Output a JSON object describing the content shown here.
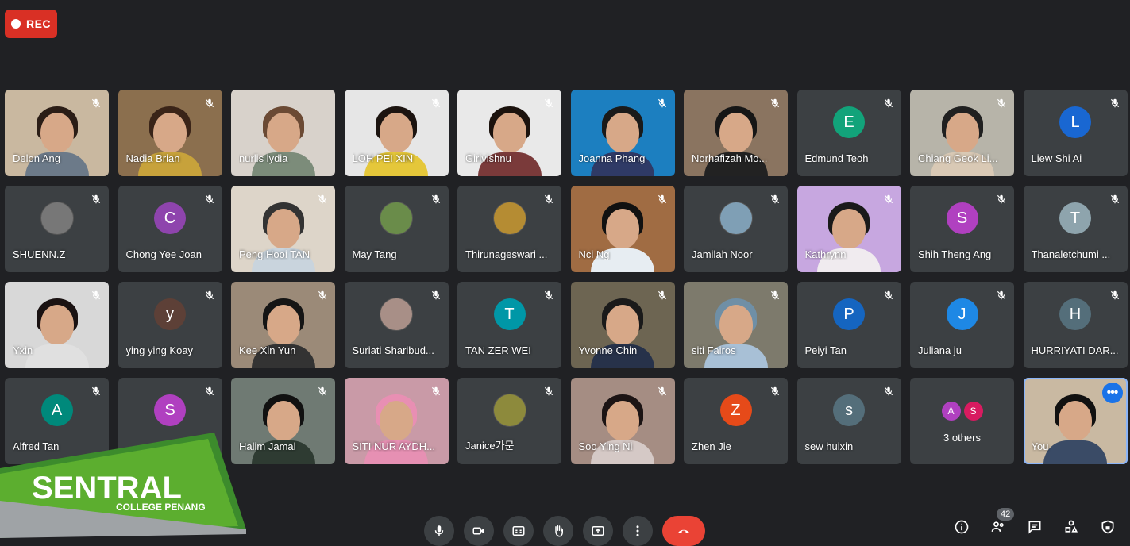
{
  "recording": {
    "label": "REC",
    "color": "#d93025"
  },
  "participants": [
    {
      "name": "Delon Ang",
      "type": "video",
      "bg": "#c9b8a0",
      "hair": "#2b1d16",
      "shirt": "#6c7a89"
    },
    {
      "name": "Nadia Brian",
      "type": "video",
      "bg": "#8b6f4e",
      "hair": "#3a2418",
      "shirt": "#c7a23b"
    },
    {
      "name": "nurlis lydia",
      "type": "video",
      "bg": "#d8d2cb",
      "hair": "#6b4a34",
      "shirt": "#7c8c7a",
      "unmuted": true
    },
    {
      "name": "LOH PEI XIN",
      "type": "video",
      "bg": "#e6e6e6",
      "hair": "#1c1410",
      "shirt": "#e5c73a"
    },
    {
      "name": "Girivishnu",
      "type": "video",
      "bg": "#e9e9e9",
      "hair": "#1b120d",
      "shirt": "#7a3a3a"
    },
    {
      "name": "Joanna Phang",
      "type": "video",
      "bg": "#1c7fc0",
      "hair": "#1a1a1a",
      "shirt": "#2f3a66"
    },
    {
      "name": "Norhafizah Mo...",
      "type": "video",
      "bg": "#8a7460",
      "hair": "#161616",
      "shirt": "#222"
    },
    {
      "name": "Edmund Teoh",
      "type": "avatar",
      "letter": "E",
      "color": "#12a37a"
    },
    {
      "name": "Chiang Geok Li...",
      "type": "video",
      "bg": "#b7b4a9",
      "hair": "#202020",
      "shirt": "#d9c9b5"
    },
    {
      "name": "Liew Shi Ai",
      "type": "avatar",
      "letter": "L",
      "color": "#1967d2"
    },
    {
      "name": "SHUENN.Z",
      "type": "photo",
      "color": "#777"
    },
    {
      "name": "Chong Yee Joan",
      "type": "avatar",
      "letter": "C",
      "color": "#8e44ad"
    },
    {
      "name": "Peng Hooi TAN",
      "type": "video",
      "bg": "#ddd5c9",
      "hair": "#333",
      "shirt": "#c9d4dd"
    },
    {
      "name": "May Tang",
      "type": "photo",
      "color": "#6a8c4a"
    },
    {
      "name": "Thirunageswari ...",
      "type": "photo",
      "color": "#b58c33"
    },
    {
      "name": "Nci Ng",
      "type": "video",
      "bg": "#a06c43",
      "hair": "#111",
      "shirt": "#e7edf2"
    },
    {
      "name": "Jamilah Noor",
      "type": "photo",
      "color": "#7f9fb5"
    },
    {
      "name": "Kathrynn",
      "type": "video",
      "bg": "#c7a7e0",
      "hair": "#1a1a1a",
      "shirt": "#f0ebef"
    },
    {
      "name": "Shih Theng Ang",
      "type": "avatar",
      "letter": "S",
      "color": "#b040c0"
    },
    {
      "name": "Thanaletchumi ...",
      "type": "avatar",
      "letter": "T",
      "color": "#8ea4ad"
    },
    {
      "name": "Yxin",
      "type": "video",
      "bg": "#d8d8d8",
      "hair": "#1a1212",
      "shirt": "#e0e0e0"
    },
    {
      "name": "ying ying Koay",
      "type": "avatar",
      "letter": "y",
      "color": "#5d4037"
    },
    {
      "name": "Kee Xin Yun",
      "type": "video",
      "bg": "#9b8a78",
      "hair": "#151515",
      "shirt": "#333"
    },
    {
      "name": "Suriati Sharibud...",
      "type": "photo",
      "color": "#a88f87"
    },
    {
      "name": "TAN ZER WEI",
      "type": "avatar",
      "letter": "T",
      "color": "#0097a7"
    },
    {
      "name": "Yvonne Chin",
      "type": "video",
      "bg": "#6d6552",
      "hair": "#1a1a1a",
      "shirt": "#27324a"
    },
    {
      "name": "siti Fairos",
      "type": "video",
      "bg": "#7d7a6c",
      "hair": "#6f8fa6",
      "shirt": "#a8c0d6"
    },
    {
      "name": "Peiyi Tan",
      "type": "avatar",
      "letter": "P",
      "color": "#1565c0"
    },
    {
      "name": "Juliana ju",
      "type": "avatar",
      "letter": "J",
      "color": "#1e88e5"
    },
    {
      "name": "HURRIYATI DAR...",
      "type": "avatar",
      "letter": "H",
      "color": "#546e7a"
    },
    {
      "name": "Alfred Tan",
      "type": "avatar",
      "letter": "A",
      "color": "#00897b"
    },
    {
      "name": "",
      "type": "avatar",
      "letter": "S",
      "color": "#b040c0"
    },
    {
      "name": "Halim Jamal",
      "type": "video",
      "bg": "#6f7a73",
      "hair": "#111",
      "shirt": "#2e3b32"
    },
    {
      "name": "SITI NUR AYDH...",
      "type": "video",
      "bg": "#c99aa7",
      "hair": "#e88fb3",
      "shirt": "#e690b3"
    },
    {
      "name": "Janice가문",
      "type": "photo",
      "color": "#8d8a3c"
    },
    {
      "name": "Soo Ying Ni",
      "type": "video",
      "bg": "#a58d83",
      "hair": "#1c1414",
      "shirt": "#d5c9c6"
    },
    {
      "name": "Zhen Jie",
      "type": "avatar",
      "letter": "Z",
      "color": "#e64a19"
    },
    {
      "name": "sew huixin",
      "type": "avatar",
      "letter": "s",
      "color": "#546e7a"
    },
    {
      "name": "3 others",
      "type": "others",
      "letters": [
        "A",
        "S"
      ],
      "colors": [
        "#b040c0",
        "#d81b60"
      ]
    },
    {
      "name": "You",
      "type": "self",
      "bg": "#c9b9a2",
      "hair": "#111",
      "shirt": "#3a4b66"
    }
  ],
  "logo": {
    "title": "SENTRAL",
    "subtitle": "COLLEGE PENANG"
  },
  "controls": [
    "mic-icon",
    "camera-icon",
    "captions-icon",
    "raise-hand-icon",
    "present-icon",
    "more-options-icon",
    "end-call-icon"
  ],
  "right_controls": {
    "people_count": "42"
  }
}
